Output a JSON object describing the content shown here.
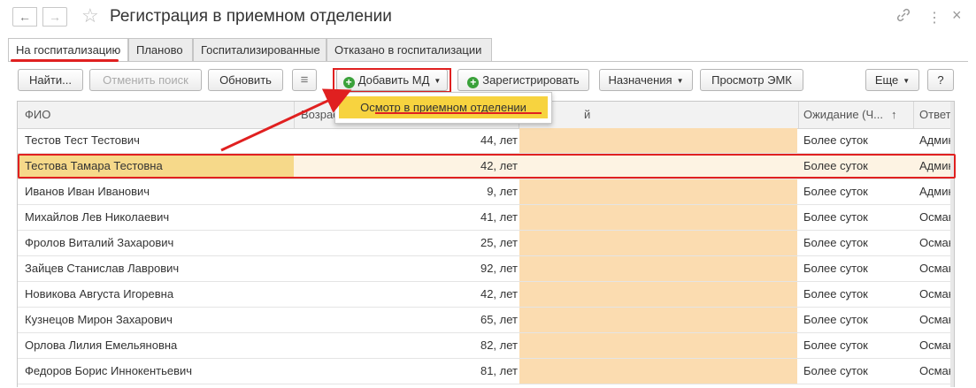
{
  "window": {
    "title": "Регистрация в приемном отделении",
    "back_glyph": "←",
    "forward_glyph": "→",
    "star_glyph": "☆",
    "link_glyph": "🔗",
    "more_glyph": "⋮",
    "close_glyph": "×"
  },
  "tabs": [
    {
      "label": "На госпитализацию",
      "active": true
    },
    {
      "label": "Планово",
      "active": false
    },
    {
      "label": "Госпитализированные",
      "active": false
    },
    {
      "label": "Отказано в госпитализации",
      "active": false
    }
  ],
  "toolbar": {
    "find": "Найти...",
    "cancel_search": "Отменить поиск",
    "refresh": "Обновить",
    "list_icon": "≡",
    "add_md": "Добавить МД",
    "register": "Зарегистрировать",
    "assignments": "Назначения",
    "view_emk": "Просмотр ЭМК",
    "more": "Еще",
    "help": "?",
    "plus_glyph": "+",
    "caret_glyph": "▼"
  },
  "dropdown": {
    "items": [
      "Осмотр в приемном отделении"
    ]
  },
  "grid": {
    "columns": {
      "name": "ФИО",
      "age": "Возраст",
      "status_tail": "й",
      "wait": "Ожидание (Ч...",
      "wait_sort": "↑",
      "resp": "Ответс"
    },
    "rows": [
      {
        "name": "Тестов Тест Тестович",
        "age": "44, лет",
        "wait": "Более суток",
        "resp": "Админ"
      },
      {
        "name": "Тестова Тамара Тестовна",
        "age": "42, лет",
        "wait": "Более суток",
        "resp": "Админ",
        "selected": true
      },
      {
        "name": "Иванов Иван Иванович",
        "age": "9, лет",
        "wait": "Более суток",
        "resp": "Админ"
      },
      {
        "name": "Михайлов Лев Николаевич",
        "age": "41, лет",
        "wait": "Более суток",
        "resp": "Осман"
      },
      {
        "name": "Фролов Виталий Захарович",
        "age": "25, лет",
        "wait": "Более суток",
        "resp": "Осман"
      },
      {
        "name": "Зайцев Станислав Лаврович",
        "age": "92, лет",
        "wait": "Более суток",
        "resp": "Осман"
      },
      {
        "name": "Новикова Августа Игоревна",
        "age": "42, лет",
        "wait": "Более суток",
        "resp": "Осман"
      },
      {
        "name": "Кузнецов Мирон Захарович",
        "age": "65, лет",
        "wait": "Более суток",
        "resp": "Осман"
      },
      {
        "name": "Орлова Лилия Емельяновна",
        "age": "82, лет",
        "wait": "Более суток",
        "resp": "Осман"
      },
      {
        "name": "Федоров Борис Иннокентьевич",
        "age": "81, лет",
        "wait": "Более суток",
        "resp": "Осман"
      }
    ]
  },
  "colors": {
    "annotation": "#e02020",
    "status_fill": "#fbdcb0",
    "menu_highlight": "#f7d33f"
  }
}
